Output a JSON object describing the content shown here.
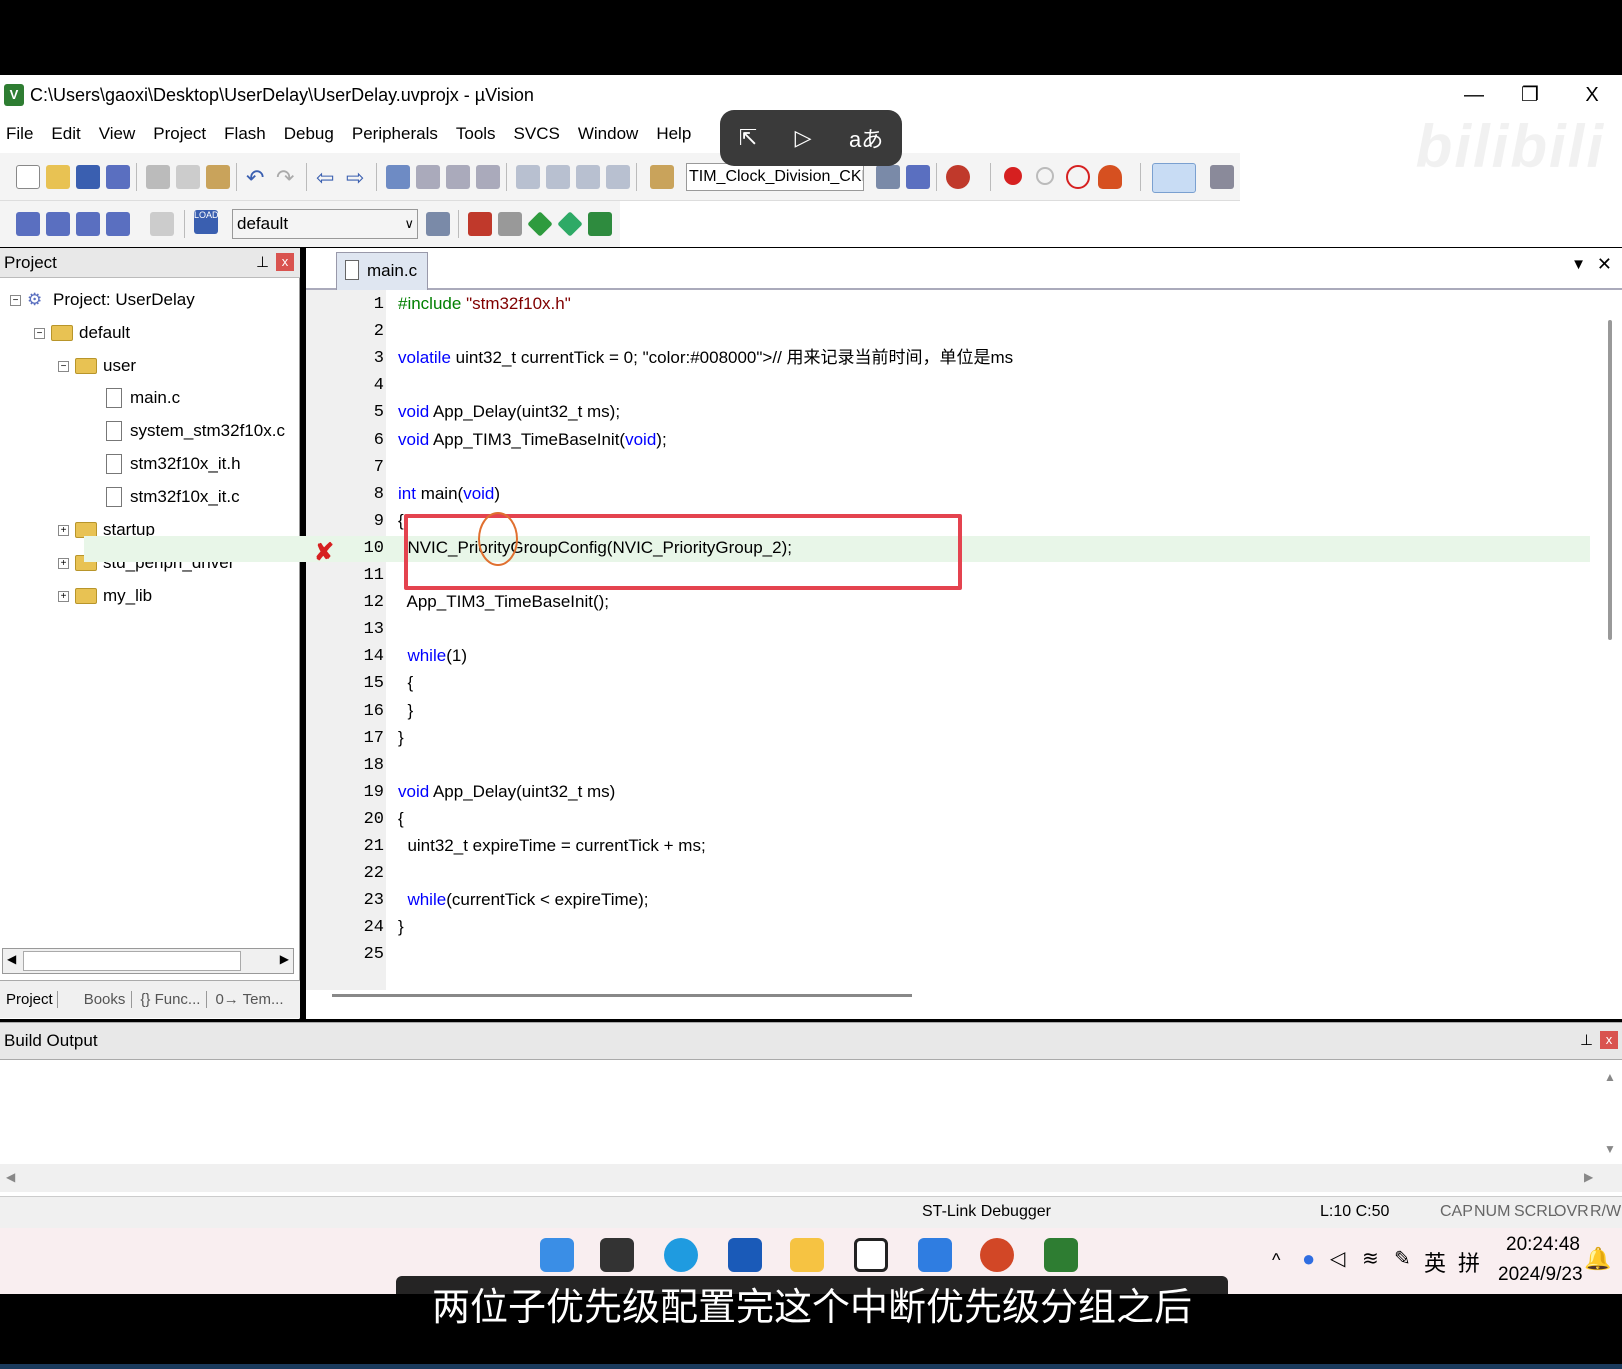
{
  "window": {
    "title": "C:\\Users\\gaoxi\\Desktop\\UserDelay\\UserDelay.uvprojx - µVision",
    "minimize": "—",
    "restore": "❐",
    "close": "X"
  },
  "menu": [
    "File",
    "Edit",
    "View",
    "Project",
    "Flash",
    "Debug",
    "Peripherals",
    "Tools",
    "SVCS",
    "Window",
    "Help"
  ],
  "overlay": {
    "icon1": "⇱",
    "icon2": "▷",
    "icon3": "aあ"
  },
  "watermark": "bilibili",
  "toolbar": {
    "target_select": "TIM_Clock_Division_CKD",
    "build_target": "default"
  },
  "project_panel": {
    "title": "Project",
    "pin": "𝟭",
    "close": "x",
    "tree": {
      "root": "Project: UserDelay",
      "target": "default",
      "group_user": "user",
      "files": [
        "main.c",
        "system_stm32f10x.c",
        "stm32f10x_it.h",
        "stm32f10x_it.c"
      ],
      "groups": [
        "startup",
        "std_periph_driver",
        "my_lib"
      ]
    },
    "tabs": [
      "Project",
      "Books",
      "{} Func...",
      "0→ Tem..."
    ]
  },
  "editor": {
    "tab": "main.c",
    "error_marker": "✘",
    "lines": [
      {
        "n": "1",
        "text": "#include \"stm32f10x.h\""
      },
      {
        "n": "2",
        "text": ""
      },
      {
        "n": "3",
        "text": "volatile uint32_t currentTick = 0; // 用来记录当前时间，单位是ms"
      },
      {
        "n": "4",
        "text": ""
      },
      {
        "n": "5",
        "text": "void App_Delay(uint32_t ms);"
      },
      {
        "n": "6",
        "text": "void App_TIM3_TimeBaseInit(void);"
      },
      {
        "n": "7",
        "text": ""
      },
      {
        "n": "8",
        "text": "int main(void)"
      },
      {
        "n": "9",
        "text": "{"
      },
      {
        "n": "10",
        "text": "  NVIC_PriorityGroupConfig(NVIC_PriorityGroup_2);"
      },
      {
        "n": "11",
        "text": ""
      },
      {
        "n": "12",
        "text": "  App_TIM3_TimeBaseInit();"
      },
      {
        "n": "13",
        "text": ""
      },
      {
        "n": "14",
        "text": "  while(1)"
      },
      {
        "n": "15",
        "text": "  {"
      },
      {
        "n": "16",
        "text": "  }"
      },
      {
        "n": "17",
        "text": "}"
      },
      {
        "n": "18",
        "text": ""
      },
      {
        "n": "19",
        "text": "void App_Delay(uint32_t ms)"
      },
      {
        "n": "20",
        "text": "{"
      },
      {
        "n": "21",
        "text": "  uint32_t expireTime = currentTick + ms;"
      },
      {
        "n": "22",
        "text": ""
      },
      {
        "n": "23",
        "text": "  while(currentTick < expireTime);"
      },
      {
        "n": "24",
        "text": "}"
      },
      {
        "n": "25",
        "text": ""
      }
    ]
  },
  "build_output": {
    "title": "Build Output"
  },
  "status": {
    "debugger": "ST-Link Debugger",
    "position": "L:10 C:50",
    "cap": "CAP",
    "num": "NUM",
    "scrl": "SCRL",
    "ovr": "OVR",
    "rw": "R/W"
  },
  "taskbar": {
    "time": "20:24:48",
    "date": "2024/9/23",
    "ime1": "英",
    "ime2": "拼"
  },
  "subtitle": "两位子优先级配置完这个中断优先级分组之后",
  "colors": {
    "keyword": "#0000ff",
    "string": "#800000",
    "comment": "#008000",
    "highlight_box": "#e4434f"
  }
}
